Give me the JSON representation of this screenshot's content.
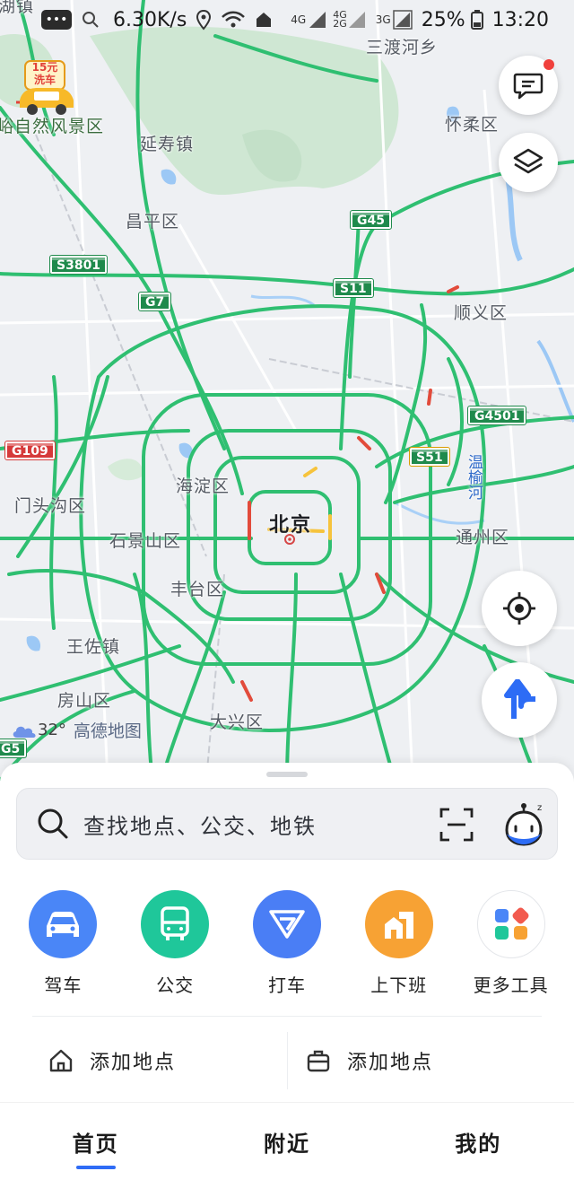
{
  "status_bar": {
    "msg_icon": "message-icon",
    "speed": "6.30K/s",
    "net1": "4G",
    "net2": "4G",
    "net3": "2G",
    "net4": "3G",
    "battery": "25%",
    "time": "13:20"
  },
  "map": {
    "labels": {
      "sandu": "三渡河乡",
      "scenic": "峪自然风景区",
      "yanshou": "延寿镇",
      "huairou": "怀柔区",
      "changping": "昌平区",
      "shunyi": "顺义区",
      "mentougou": "门头沟区",
      "haidian": "海淀区",
      "beijing": "北京",
      "shijingshan": "石景山区",
      "tongzhou": "通州区",
      "fengtai": "丰台区",
      "wangzuo": "王佐镇",
      "fangshan": "房山区",
      "daxing": "大兴区",
      "river": "温榆河",
      "top_left": "湖镇"
    },
    "shields": {
      "g45": "G45",
      "s3801": "S3801",
      "s11": "S11",
      "g7": "G7",
      "g4501": "G4501",
      "g109": "G109",
      "s51": "S51",
      "g5": "G5"
    },
    "promo": {
      "price": "15元",
      "text": "洗车"
    },
    "weather": {
      "temp": "32°",
      "logo": "高德地图"
    },
    "colors": {
      "road": "#2fbf71",
      "congestion_red": "#e24b3b",
      "congestion_yellow": "#f6c33c",
      "water": "#9cc8f5",
      "green_area": "#cfe7d3"
    }
  },
  "sheet": {
    "search_placeholder": "查找地点、公交、地铁",
    "quick_actions": [
      {
        "label": "驾车",
        "icon": "car-icon",
        "color": "#4a86f7"
      },
      {
        "label": "公交",
        "icon": "bus-icon",
        "color": "#1fc79a"
      },
      {
        "label": "打车",
        "icon": "taxi-icon",
        "color": "#4a7ef5"
      },
      {
        "label": "上下班",
        "icon": "commute-icon",
        "color": "#f7a234"
      },
      {
        "label": "更多工具",
        "icon": "more-tools-icon",
        "color": "#ffffff"
      }
    ],
    "places": [
      {
        "label": "添加地点",
        "icon": "home-icon"
      },
      {
        "label": "添加地点",
        "icon": "work-icon"
      }
    ]
  },
  "nav": {
    "items": [
      "首页",
      "附近",
      "我的"
    ],
    "active": "首页",
    "accent": "#2f6cf6"
  }
}
